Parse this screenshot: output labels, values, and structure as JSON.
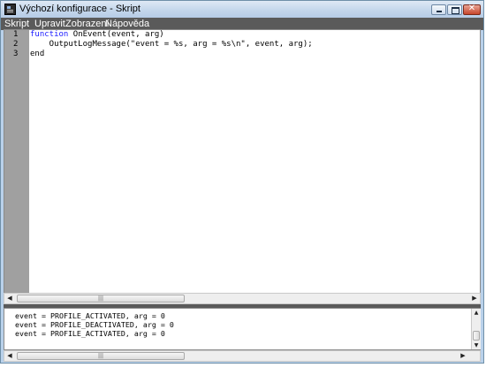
{
  "window": {
    "title": "Výchozí konfigurace - Skript"
  },
  "titlebar_buttons": {
    "close_glyph": "✕"
  },
  "menu": {
    "items": [
      {
        "label": "Skript"
      },
      {
        "label": "Upravit"
      },
      {
        "label": "Zobrazení"
      },
      {
        "label": "Nápověda"
      }
    ]
  },
  "editor": {
    "lines": [
      {
        "number": "1",
        "keyword": "function",
        "rest": " OnEvent(event, arg)"
      },
      {
        "number": "2",
        "keyword": "",
        "rest": "    OutputLogMessage(\"event = %s, arg = %s\\n\", event, arg);"
      },
      {
        "number": "3",
        "keyword": "",
        "rest": "end"
      }
    ]
  },
  "output": {
    "lines": [
      "event = PROFILE_ACTIVATED, arg = 0",
      "event = PROFILE_DEACTIVATED, arg = 0",
      "event = PROFILE_ACTIVATED, arg = 0"
    ]
  },
  "scrollbar": {
    "left_arrow": "◀",
    "right_arrow": "▶",
    "up_arrow": "▲",
    "down_arrow": "▼",
    "grip": "|||"
  },
  "colors": {
    "keyword": "#1a1aff",
    "menubar": "#5a5a5a",
    "gutter": "#a0a0a0"
  }
}
